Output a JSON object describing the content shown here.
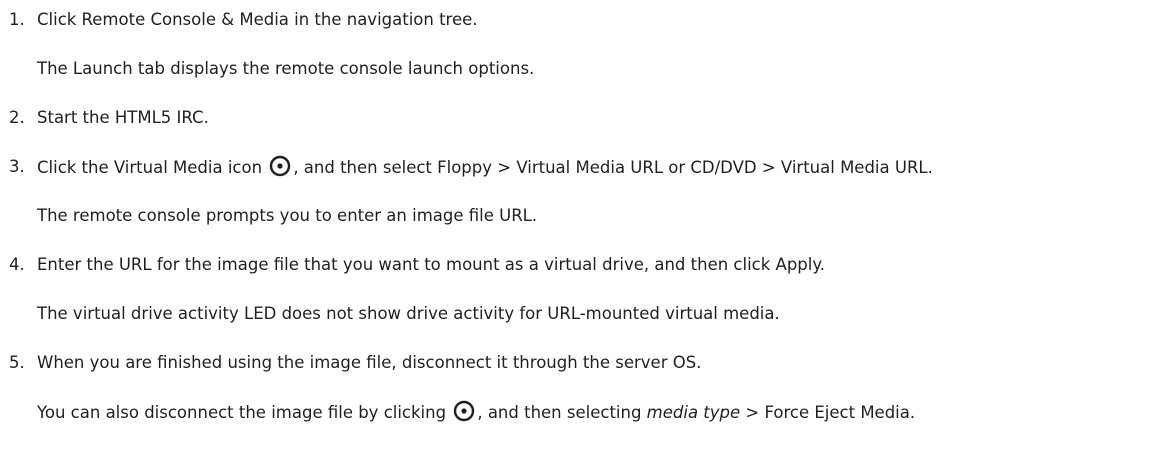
{
  "steps": [
    {
      "number": "1.",
      "text": "Click Remote Console & Media in the navigation tree.",
      "result": "The Launch tab displays the remote console launch options."
    },
    {
      "number": "2.",
      "text": "Start the HTML5 IRC."
    },
    {
      "number": "3.",
      "text_before_icon": "Click the Virtual Media icon",
      "text_after_icon": ", and then select Floppy > Virtual Media URL or CD/DVD > Virtual Media URL.",
      "icon": "virtual-media-icon",
      "result": "The remote console prompts you to enter an image file URL."
    },
    {
      "number": "4.",
      "text": "Enter the URL for the image file that you want to mount as a virtual drive, and then click Apply.",
      "result": "The virtual drive activity LED does not show drive activity for URL-mounted virtual media."
    },
    {
      "number": "5.",
      "text": "When you are finished using the image file, disconnect it through the server OS.",
      "result_before_icon": "You can also disconnect the image file by clicking",
      "result_after_icon_1": ", and then selecting ",
      "result_italic": "media type",
      "result_after_icon_2": " > Force Eject Media.",
      "icon": "virtual-media-icon"
    }
  ]
}
